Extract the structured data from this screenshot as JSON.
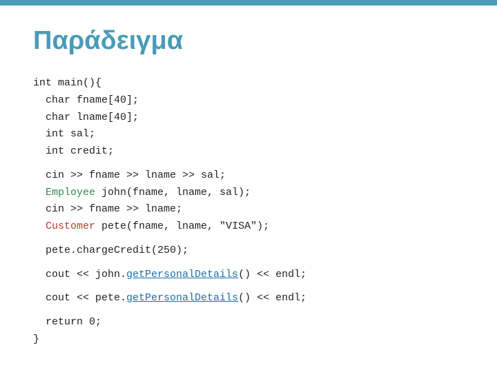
{
  "slide": {
    "title": "Παράδειγμα",
    "top_bar_color": "#4a9bb8",
    "background": "#ffffff"
  },
  "code": {
    "lines": [
      {
        "id": "l1",
        "text": "int main(){"
      },
      {
        "id": "l2",
        "text": "  char fname[40];"
      },
      {
        "id": "l3",
        "text": "  char lname[40];"
      },
      {
        "id": "l4",
        "text": "  int sal;"
      },
      {
        "id": "l5",
        "text": "  int credit;"
      },
      {
        "id": "gap1",
        "text": ""
      },
      {
        "id": "l6",
        "text": "  cin >> fname >> lname >> sal;"
      },
      {
        "id": "l7_pre",
        "text": "  ",
        "l7_kw": "Employee",
        "l7_rest": " john(fname, lname, sal);"
      },
      {
        "id": "l8",
        "text": "  cin >> fname >> lname;"
      },
      {
        "id": "l9_pre",
        "text": "  ",
        "l9_kw": "Customer",
        "l9_rest": " pete(fname, lname, \"VISA\");"
      },
      {
        "id": "gap2",
        "text": ""
      },
      {
        "id": "l10",
        "text": "  pete.chargeCredit(250);"
      },
      {
        "id": "gap3",
        "text": ""
      },
      {
        "id": "l11_pre",
        "text": "  cout << john.",
        "l11_method": "getPersonalDetails",
        "l11_rest": "() << endl;"
      },
      {
        "id": "gap4",
        "text": ""
      },
      {
        "id": "l12_pre",
        "text": "  cout << pete.",
        "l12_method": "getPersonalDetails",
        "l12_rest": "() << endl;"
      },
      {
        "id": "gap5",
        "text": ""
      },
      {
        "id": "l13",
        "text": "  return 0;"
      },
      {
        "id": "l14",
        "text": "}"
      }
    ]
  }
}
